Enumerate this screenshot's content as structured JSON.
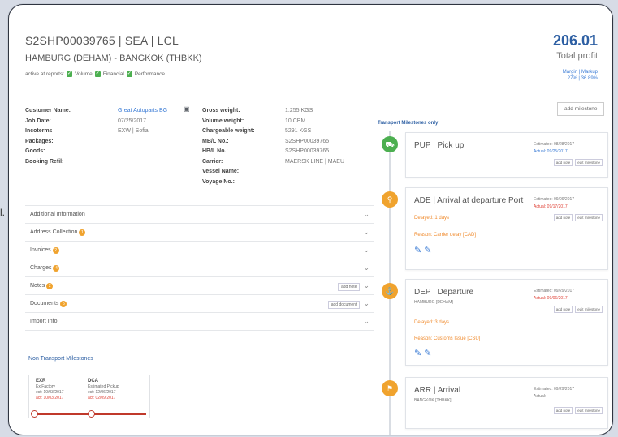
{
  "side_fragment": "l.",
  "shipment": {
    "title": "S2SHP00039765 | SEA | LCL",
    "route": "HAMBURG (DEHAM) - BANGKOK (THBKK)",
    "active_reports_label": "active at reports:",
    "report_checks": [
      "Volume",
      "Financial",
      "Performance"
    ]
  },
  "profit": {
    "value": "206.01",
    "label": "Total profit",
    "margin_line": "Margin | Markup",
    "margin_value": "27% | 36.89%"
  },
  "details": {
    "left": [
      {
        "label": "Customer Name:",
        "value": "Great Autoparts BG"
      },
      {
        "label": "Job Date:",
        "value": "07/25/2017"
      },
      {
        "label": "Incoterms",
        "value": "EXW | Sofia"
      },
      {
        "label": "Packages:",
        "value": ""
      },
      {
        "label": "Goods:",
        "value": ""
      },
      {
        "label": "Booking Refil:",
        "value": ""
      }
    ],
    "right": [
      {
        "label": "Gross weight:",
        "value": "1.255 KGS"
      },
      {
        "label": "Volume weight:",
        "value": "10 CBM"
      },
      {
        "label": "Chargeable weight:",
        "value": "5291 KGS"
      },
      {
        "label": "MB/L No.:",
        "value": "S2SHP00039765"
      },
      {
        "label": "HB/L No.:",
        "value": "S2SHP00039765"
      },
      {
        "label": "Carrier:",
        "value": "MAERSK LINE | MAEU"
      },
      {
        "label": "Vessel Name:",
        "value": ""
      },
      {
        "label": "Voyage No.:",
        "value": ""
      }
    ]
  },
  "add_milestone_label": "add milestone",
  "transport_only_label": "Transport Milestones only",
  "accordion": [
    {
      "label": "Additional Information",
      "badge": ""
    },
    {
      "label": "Address Collection",
      "badge": "1"
    },
    {
      "label": "Invoices",
      "badge": "2"
    },
    {
      "label": "Charges",
      "badge": "4"
    },
    {
      "label": "Notes",
      "badge": "2",
      "button": "add note"
    },
    {
      "label": "Documents",
      "badge": "5",
      "button": "add document"
    },
    {
      "label": "Import Info",
      "badge": ""
    }
  ],
  "non_transport": {
    "title": "Non Transport Milestones",
    "items": [
      {
        "code": "EXR",
        "name": "Ex Factory",
        "est": "est: 10/03/2017",
        "act": "act: 10/03/2017"
      },
      {
        "code": "DCA",
        "name": "Estimated Pickup",
        "est": "est: 12/06/2017",
        "act": "act: 02/09/2017"
      }
    ]
  },
  "milestones": [
    {
      "title": "PUP | Pick up",
      "sub": "",
      "delay": "",
      "reason": "",
      "est": "Estimated: 08/28/2017",
      "act": "Actual: 09/25/2017",
      "color": "#4caf50",
      "icon": "⛟"
    },
    {
      "title": "ADE | Arrival at departure Port",
      "sub": "",
      "delay": "Delayed: 1 days",
      "reason": "Reason: Carrier delay [CAD]",
      "est": "Estimated: 09/09/2017",
      "act": "Actual: 09/17/2017",
      "color": "#f0a32e",
      "icon": "⚲"
    },
    {
      "title": "DEP | Departure",
      "sub": "HAMBURG [DEHAM]",
      "delay": "Delayed: 3 days",
      "reason": "Reason: Customs Issue [CSU]",
      "est": "Estimated: 09/29/2017",
      "act": "Actual: 09/06/2017",
      "color": "#f0a32e",
      "icon": "⚓"
    },
    {
      "title": "ARR | Arrival",
      "sub": "BANGKOK [THBKK]",
      "delay": "",
      "reason": "",
      "est": "Estimated: 09/29/2017",
      "act": "Actual:",
      "color": "#f0a32e",
      "icon": "⚑"
    }
  ],
  "milestone_buttons": [
    "add note",
    "edit milestone"
  ]
}
